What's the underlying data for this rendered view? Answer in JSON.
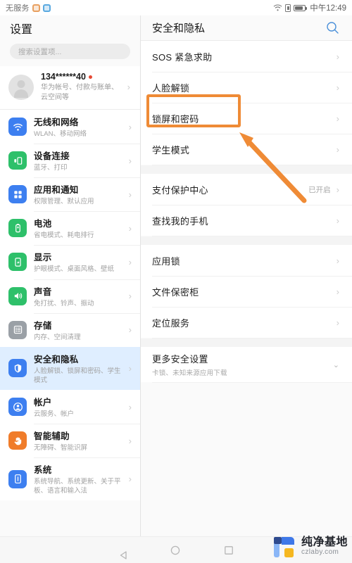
{
  "status_bar": {
    "carrier": "无服务",
    "time": "中午12:49",
    "icons": [
      "app-icon-orange",
      "app-icon-blue",
      "wifi-icon",
      "sim-card-icon",
      "battery-icon"
    ]
  },
  "left_panel": {
    "title": "设置",
    "search_placeholder": "搜索设置项...",
    "account": {
      "id": "134******40",
      "subtitle": "华为帐号、付款与账单、云空间等",
      "has_badge": true
    },
    "items": [
      {
        "title": "无线和网络",
        "subtitle": "WLAN、移动网络",
        "icon": "wifi-icon",
        "color": "#3d7ff0",
        "selected": false
      },
      {
        "title": "设备连接",
        "subtitle": "蓝牙、打印",
        "icon": "device-connect-icon",
        "color": "#2ec06a",
        "selected": false
      },
      {
        "title": "应用和通知",
        "subtitle": "权限管理、默认应用",
        "icon": "apps-icon",
        "color": "#3d7ff0",
        "selected": false
      },
      {
        "title": "电池",
        "subtitle": "省电模式、耗电排行",
        "icon": "battery-icon",
        "color": "#2ec06a",
        "selected": false
      },
      {
        "title": "显示",
        "subtitle": "护眼模式、桌面风格、壁纸",
        "icon": "display-icon",
        "color": "#2ec06a",
        "selected": false
      },
      {
        "title": "声音",
        "subtitle": "免打扰、铃声、振动",
        "icon": "sound-icon",
        "color": "#2ec06a",
        "selected": false
      },
      {
        "title": "存储",
        "subtitle": "内存、空间清理",
        "icon": "storage-icon",
        "color": "#9aa0a6",
        "selected": false
      },
      {
        "title": "安全和隐私",
        "subtitle": "人脸解锁、锁屏和密码、学生模式",
        "icon": "shield-icon",
        "color": "#3d7ff0",
        "selected": true
      },
      {
        "title": "帐户",
        "subtitle": "云服务、帐户",
        "icon": "account-icon",
        "color": "#3d7ff0",
        "selected": false
      },
      {
        "title": "智能辅助",
        "subtitle": "无障碍、智能识屏",
        "icon": "hand-icon",
        "color": "#f07c2a",
        "selected": false
      },
      {
        "title": "系统",
        "subtitle": "系统导航、系统更新、关于平板、语言和输入法",
        "icon": "system-info-icon",
        "color": "#3d7ff0",
        "selected": false
      }
    ]
  },
  "right_panel": {
    "title": "安全和隐私",
    "search_icon": "search-icon",
    "accent_color": "#4a90d9",
    "groups": [
      {
        "items": [
          {
            "title": "SOS 紧急求助",
            "value": "",
            "subtitle": "",
            "chevron": "chevron-right-icon",
            "highlighted": false
          },
          {
            "title": "人脸解锁",
            "value": "",
            "subtitle": "",
            "chevron": "chevron-right-icon",
            "highlighted": false
          },
          {
            "title": "锁屏和密码",
            "value": "",
            "subtitle": "",
            "chevron": "chevron-right-icon",
            "highlighted": true
          },
          {
            "title": "学生模式",
            "value": "",
            "subtitle": "",
            "chevron": "chevron-right-icon",
            "highlighted": false
          }
        ]
      },
      {
        "items": [
          {
            "title": "支付保护中心",
            "value": "已开启",
            "subtitle": "",
            "chevron": "chevron-right-icon",
            "highlighted": false
          },
          {
            "title": "查找我的手机",
            "value": "",
            "subtitle": "",
            "chevron": "chevron-right-icon",
            "highlighted": false
          }
        ]
      },
      {
        "items": [
          {
            "title": "应用锁",
            "value": "",
            "subtitle": "",
            "chevron": "chevron-right-icon",
            "highlighted": false
          },
          {
            "title": "文件保密柜",
            "value": "",
            "subtitle": "",
            "chevron": "chevron-right-icon",
            "highlighted": false
          },
          {
            "title": "定位服务",
            "value": "",
            "subtitle": "",
            "chevron": "chevron-right-icon",
            "highlighted": false
          }
        ]
      },
      {
        "items": [
          {
            "title": "更多安全设置",
            "value": "",
            "subtitle": "卡锁、未知来源应用下载",
            "chevron": "chevron-down-icon",
            "highlighted": false
          }
        ]
      }
    ]
  },
  "annotation": {
    "box_color": "#ef8b36",
    "arrow_color": "#ef8b36",
    "target_label": "锁屏和密码"
  },
  "nav_bar": {
    "back": "back-triangle-icon",
    "home": "home-circle-icon",
    "recents": "recents-square-icon"
  },
  "watermark": {
    "name": "纯净基地",
    "url": "czlaby.com"
  }
}
